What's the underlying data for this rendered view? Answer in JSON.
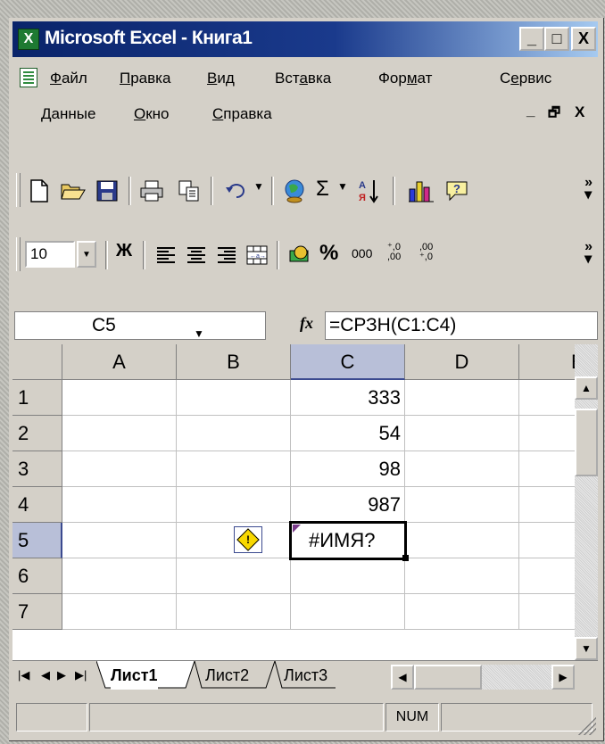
{
  "window": {
    "app_icon": "excel-icon",
    "title": "Microsoft Excel - Книга1",
    "caption_buttons": {
      "minimize": "_",
      "maximize": "□",
      "close": "X"
    }
  },
  "menubar": {
    "items": [
      {
        "pre": "",
        "u": "Ф",
        "post": "айл"
      },
      {
        "pre": "",
        "u": "П",
        "post": "равка"
      },
      {
        "pre": "",
        "u": "В",
        "post": "ид"
      },
      {
        "pre": "Вст",
        "u": "а",
        "post": "вка"
      },
      {
        "pre": "Фор",
        "u": "м",
        "post": "ат"
      },
      {
        "pre": "С",
        "u": "е",
        "post": "рвис"
      },
      {
        "pre": "",
        "u": "Д",
        "post": "анные"
      },
      {
        "pre": "",
        "u": "О",
        "post": "кно"
      },
      {
        "pre": "",
        "u": "С",
        "post": "правка"
      }
    ],
    "mdi_minimize": "_",
    "mdi_restore": "🗗",
    "mdi_close": "X"
  },
  "standard_toolbar": {
    "icons": [
      "new-icon",
      "open-icon",
      "save-icon",
      "print-icon",
      "copy-icon",
      "undo-icon",
      "hyperlink-icon",
      "autosum-icon",
      "sort-ascending-icon",
      "chart-wizard-icon",
      "help-icon"
    ],
    "autosum_symbol": "Σ",
    "more": "»"
  },
  "formatting_toolbar": {
    "font_size": "10",
    "bold_label": "Ж",
    "percent": "%",
    "thousands": "000",
    "increase_decimal": "⁺,0 ,00",
    "decrease_decimal": ",00 ⁺,0",
    "more": "»"
  },
  "formula_bar": {
    "name_box": "C5",
    "fx": "fx",
    "formula": "=СРЗН(C1:C4)"
  },
  "sheet": {
    "columns": [
      "A",
      "B",
      "C",
      "D",
      "E"
    ],
    "rows": [
      "1",
      "2",
      "3",
      "4",
      "5",
      "6",
      "7"
    ],
    "active_column": "C",
    "active_row": "5",
    "cells": {
      "C1": "333",
      "C2": "54",
      "C3": "98",
      "C4": "987",
      "C5": "#ИМЯ?"
    },
    "error_smart_tag": "!"
  },
  "tabs": {
    "items": [
      "Лист1",
      "Лист2",
      "Лист3"
    ],
    "active": "Лист1"
  },
  "statusbar": {
    "num": "NUM"
  },
  "colors": {
    "title_start": "#0a246a",
    "title_end": "#a6caf0",
    "chrome": "#d4d0c8",
    "selection_header": "#b8bfd8"
  }
}
